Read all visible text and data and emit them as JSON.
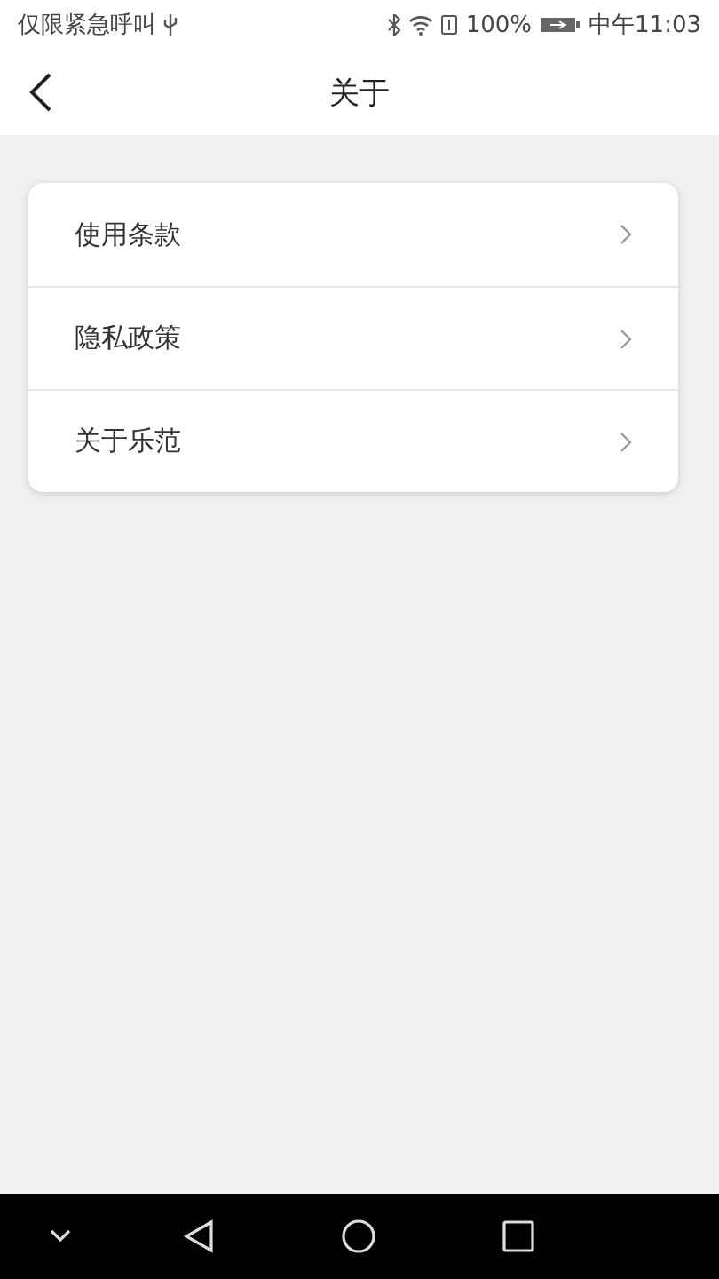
{
  "status_bar": {
    "carrier": "仅限紧急呼叫",
    "battery": "100%",
    "time": "中午11:03"
  },
  "header": {
    "title": "关于"
  },
  "menu": [
    {
      "label": "使用条款"
    },
    {
      "label": "隐私政策"
    },
    {
      "label": "关于乐范"
    }
  ]
}
